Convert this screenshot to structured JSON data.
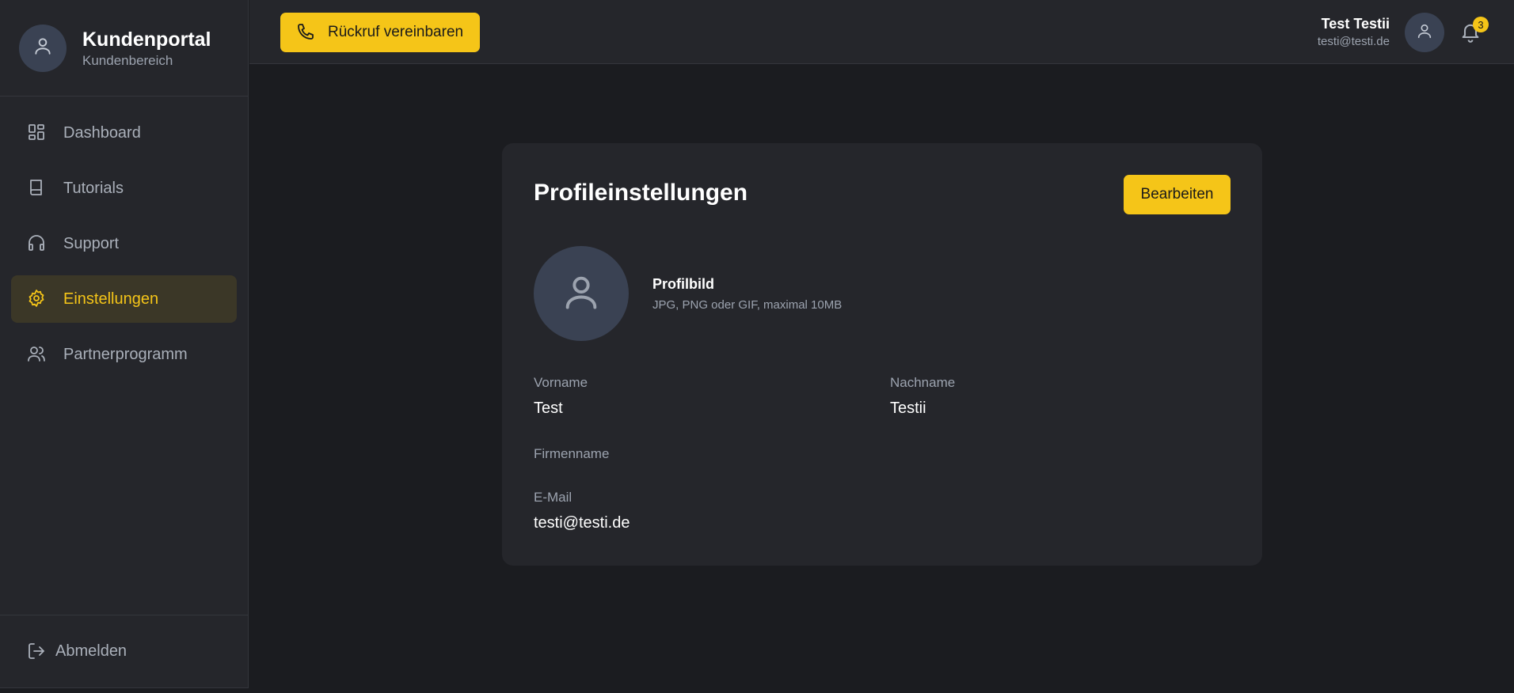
{
  "sidebar": {
    "brand_title": "Kundenportal",
    "brand_subtitle": "Kundenbereich",
    "items": [
      {
        "label": "Dashboard",
        "icon": "grid-icon"
      },
      {
        "label": "Tutorials",
        "icon": "book-icon"
      },
      {
        "label": "Support",
        "icon": "headphones-icon"
      },
      {
        "label": "Einstellungen",
        "icon": "gear-icon",
        "active": true
      },
      {
        "label": "Partnerprogramm",
        "icon": "users-icon"
      }
    ],
    "logout_label": "Abmelden"
  },
  "header": {
    "callback_label": "Rückruf vereinbaren",
    "user_name": "Test Testii",
    "user_email": "testi@testi.de",
    "notification_count": "3"
  },
  "profile": {
    "title": "Profileinstellungen",
    "edit_label": "Bearbeiten",
    "picture_label": "Profilbild",
    "picture_hint": "JPG, PNG oder GIF, maximal 10MB",
    "fields": {
      "firstname_label": "Vorname",
      "firstname_value": "Test",
      "lastname_label": "Nachname",
      "lastname_value": "Testii",
      "company_label": "Firmenname",
      "company_value": "",
      "email_label": "E-Mail",
      "email_value": "testi@testi.de"
    }
  },
  "colors": {
    "accent": "#f5c518",
    "background": "#1b1c20",
    "panel": "#25262b",
    "avatar": "#3a4253"
  }
}
